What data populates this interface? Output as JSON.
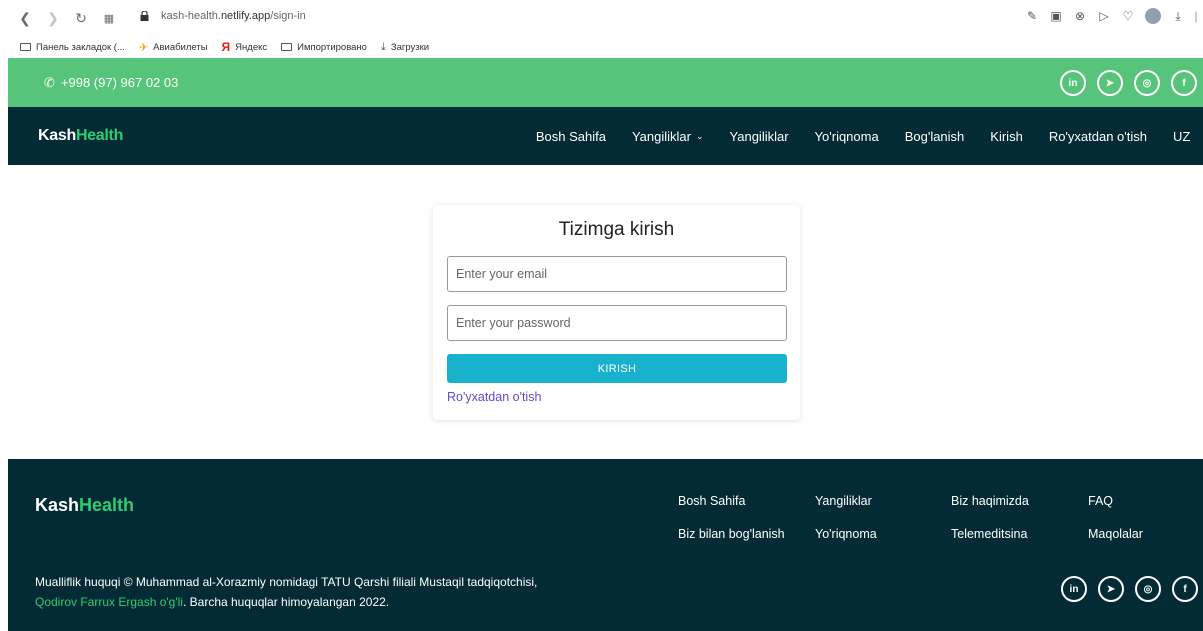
{
  "browser": {
    "url_prefix": "kash-health.",
    "url_domain": "netlify.app",
    "url_path": "/sign-in"
  },
  "bookmarks": [
    {
      "label": "Панель закладок (...",
      "icon": "folder-icon"
    },
    {
      "label": "Авиабилеты",
      "icon": "plane-icon"
    },
    {
      "label": "Яндекс",
      "icon": "yandex-icon"
    },
    {
      "label": "Импортировано",
      "icon": "folder-icon"
    },
    {
      "label": "Загрузки",
      "icon": "download-icon"
    }
  ],
  "topbar": {
    "phone": "+998 (97) 967 02 03",
    "color": "#56c47a"
  },
  "navbar": {
    "logo_part1": "Kash",
    "logo_part2": "Health",
    "items": [
      {
        "label": "Bosh Sahifa"
      },
      {
        "label": "Yangiliklar"
      },
      {
        "label": "Yangiliklar"
      },
      {
        "label": "Yo'riqnoma"
      },
      {
        "label": "Bog'lanish"
      },
      {
        "label": "Kirish"
      },
      {
        "label": "Ro'yxatdan o'tish"
      },
      {
        "label": "UZ"
      }
    ],
    "color": "#032b36"
  },
  "signin": {
    "title": "Tizimga kirish",
    "email_placeholder": "Enter your email",
    "password_placeholder": "Enter your password",
    "submit_label": "KIRISH",
    "register_link": "Ro'yxatdan o'tish",
    "button_color": "#18b2cc"
  },
  "footer": {
    "logo_part1": "Kash",
    "logo_part2": "Health",
    "links": [
      {
        "label": "Bosh Sahifa"
      },
      {
        "label": "Yangiliklar"
      },
      {
        "label": "Biz haqimizda"
      },
      {
        "label": "FAQ"
      },
      {
        "label": "Biz bilan bog'lanish"
      },
      {
        "label": "Yo'riqnoma"
      },
      {
        "label": "Telemeditsina"
      },
      {
        "label": "Maqolalar"
      }
    ],
    "copyright_line1": "Mualliflik huquqi © Muhammad al-Xorazmiy nomidagi TATU Qarshi filiali Mustaqil tadqiqotchisi,",
    "copyright_author": "Qodirov Farrux Ergash o'g'li",
    "copyright_end": ". Barcha huquqlar himoyalangan 2022.",
    "accent": "#2ecc71"
  },
  "social_icons": [
    "linkedin-icon",
    "telegram-icon",
    "instagram-icon",
    "facebook-icon"
  ]
}
